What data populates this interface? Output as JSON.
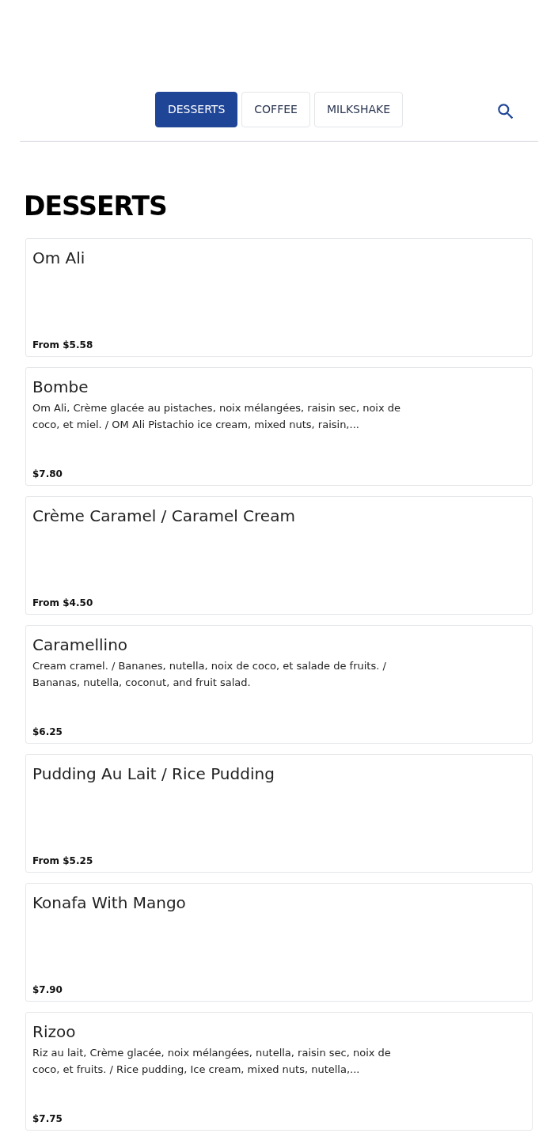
{
  "tabs": [
    {
      "label": "DESSERTS",
      "selected": true
    },
    {
      "label": "COFFEE",
      "selected": false
    },
    {
      "label": "MILKSHAKE",
      "selected": false
    }
  ],
  "section": {
    "title": "DESSERTS"
  },
  "items": [
    {
      "name": "Om Ali",
      "price": "From $5.58"
    },
    {
      "name": "Bombe",
      "description": "Om Ali, Crème glacée au pistaches, noix mélangées, raisin sec, noix de coco, et miel. / OM Ali Pistachio ice cream, mixed nuts, raisin,...",
      "price": "$7.80"
    },
    {
      "name": "Crème Caramel / Caramel Cream",
      "price": "From $4.50"
    },
    {
      "name": "Caramellino",
      "description": "Cream cramel. / Bananes, nutella, noix de coco, et salade de fruits. / Bananas, nutella, coconut, and fruit salad.",
      "price": "$6.25"
    },
    {
      "name": "Pudding Au Lait / Rice Pudding",
      "price": "From $5.25"
    },
    {
      "name": "Konafa With Mango",
      "price": "$7.90"
    },
    {
      "name": "Rizoo",
      "description": "Riz au lait, Crème glacée, noix mélangées, nutella, raisin sec, noix de coco, et fruits. / Rice pudding, Ice cream, mixed nuts, nutella,...",
      "price": "$7.75"
    }
  ]
}
